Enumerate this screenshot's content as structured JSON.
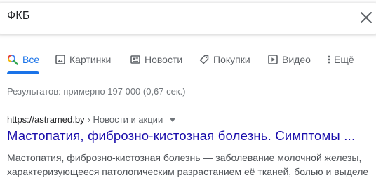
{
  "search": {
    "query": "ФКБ"
  },
  "tabs": [
    {
      "label": "Все",
      "icon": "search-icon",
      "active": true
    },
    {
      "label": "Картинки",
      "icon": "image-icon"
    },
    {
      "label": "Новости",
      "icon": "news-icon"
    },
    {
      "label": "Покупки",
      "icon": "tag-icon"
    },
    {
      "label": "Видео",
      "icon": "video-icon"
    },
    {
      "label": "Ещё",
      "icon": "more-vert-icon"
    }
  ],
  "stats": "Результатов: примерно 197 000 (0,67 сек.)",
  "result": {
    "url": "https://astramed.by",
    "breadcrumb": " › Новости и акции",
    "title": "Мастопатия, фиброзно-кистозная болезнь. Симптомы ...",
    "snippet_line1": "Мастопатия, фиброзно-кистозная болезнь — заболевание молочной железы,",
    "snippet_line2": "характеризующееся патологическим разрастанием её тканей, болью и выделе"
  },
  "colors": {
    "accent": "#1a73e8",
    "link": "#1a0dab",
    "muted": "#5f6368"
  }
}
